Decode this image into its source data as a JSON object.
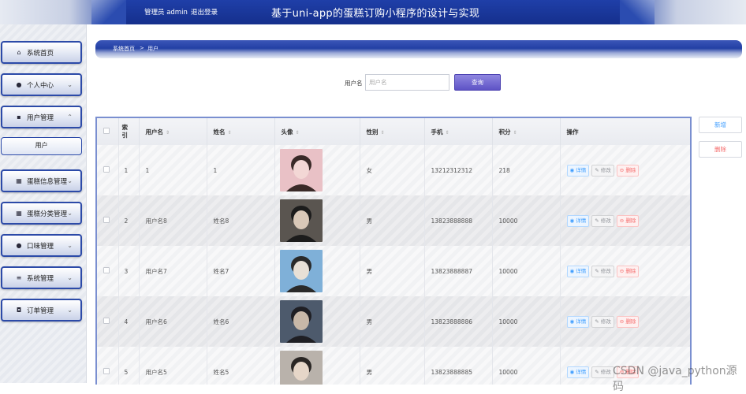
{
  "header": {
    "user": "管理员 admin",
    "logout": "退出登录",
    "title": "基于uni-app的蛋糕订购小程序的设计与实现"
  },
  "sidebar": {
    "items": [
      {
        "icon": "home-icon",
        "label": "系统首页"
      },
      {
        "icon": "user-icon",
        "label": "个人中心"
      },
      {
        "icon": "chat-icon",
        "label": "用户管理"
      },
      {
        "label": "用户"
      },
      {
        "icon": "grid-icon",
        "label": "蛋糕信息管理"
      },
      {
        "icon": "grid-icon",
        "label": "蛋糕分类管理"
      },
      {
        "icon": "person-icon",
        "label": "口味管理"
      },
      {
        "icon": "sliders-icon",
        "label": "系统管理"
      },
      {
        "icon": "box-icon",
        "label": "订单管理"
      }
    ]
  },
  "breadcrumb": {
    "home": "系统首页",
    "sep": ">",
    "current": "用户"
  },
  "search": {
    "label": "用户名",
    "placeholder": "用户名",
    "button": "查询"
  },
  "actions": {
    "add": "新增",
    "delete": "删除"
  },
  "table": {
    "headers": [
      "索引",
      "用户名",
      "姓名",
      "头像",
      "性别",
      "手机",
      "积分",
      "操作"
    ],
    "index_header_line1": "索",
    "index_header_line2": "引",
    "op_labels": {
      "view": "详情",
      "edit": "修改",
      "del": "删除"
    },
    "rows": [
      {
        "index": "1",
        "username": "1",
        "name": "1",
        "gender": "女",
        "phone": "13212312312",
        "points": "218"
      },
      {
        "index": "2",
        "username": "用户名8",
        "name": "姓名8",
        "gender": "男",
        "phone": "13823888888",
        "points": "10000"
      },
      {
        "index": "3",
        "username": "用户名7",
        "name": "姓名7",
        "gender": "男",
        "phone": "13823888887",
        "points": "10000"
      },
      {
        "index": "4",
        "username": "用户名6",
        "name": "姓名6",
        "gender": "男",
        "phone": "13823888886",
        "points": "10000"
      },
      {
        "index": "5",
        "username": "用户名5",
        "name": "姓名5",
        "gender": "男",
        "phone": "13823888885",
        "points": "10000"
      }
    ]
  },
  "watermark": "CSDN @java_python源码",
  "colors": {
    "header_bg": "#1f3fa8",
    "menu_border": "#2c4aa8",
    "search_btn": "#6a5fd0",
    "delete_text": "#f56c6c",
    "view_text": "#409eff"
  }
}
